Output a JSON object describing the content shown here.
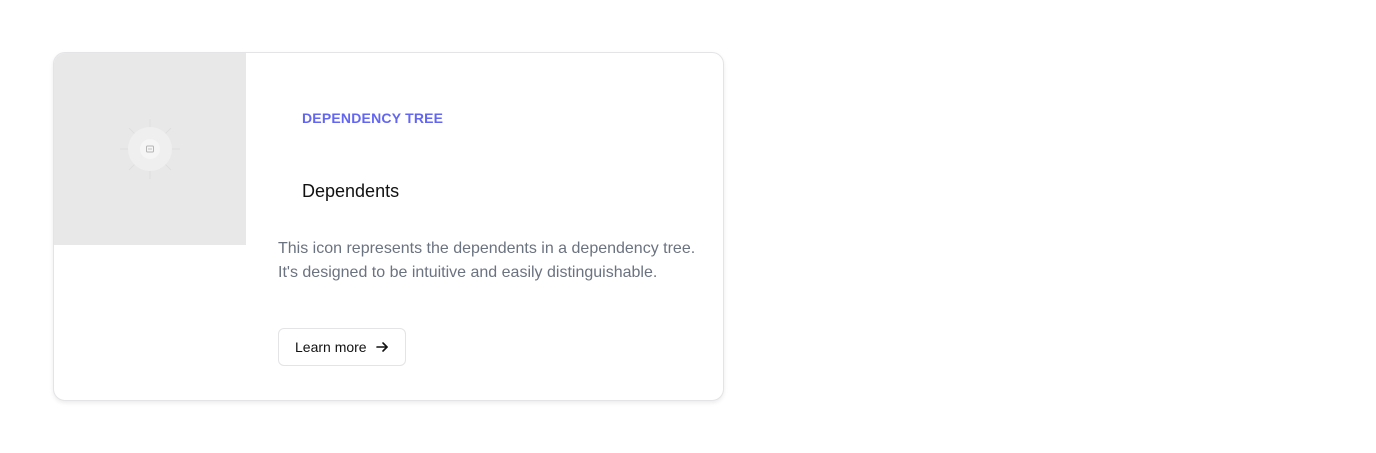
{
  "card": {
    "media_icon": "dependents-placeholder-icon",
    "eyebrow": "DEPENDENCY TREE",
    "title": "Dependents",
    "description": "This icon represents the dependents in a dependency tree. It's designed to be intuitive and easily distinguishable.",
    "button_label": "Learn more",
    "button_icon": "arrow-right-icon",
    "accent_color": "#6366f1"
  }
}
